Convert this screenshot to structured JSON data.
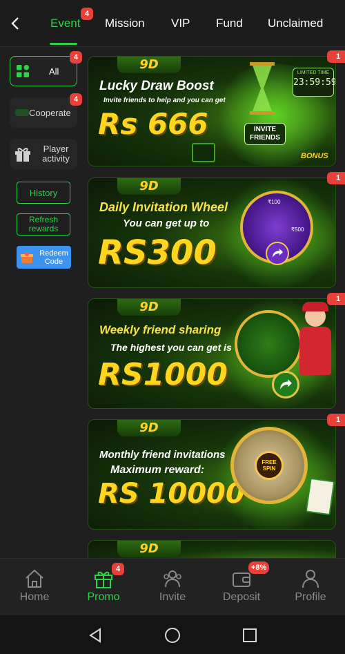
{
  "top_tabs": {
    "items": [
      {
        "label": "Event",
        "badge": "4"
      },
      {
        "label": "Mission"
      },
      {
        "label": "VIP"
      },
      {
        "label": "Fund"
      },
      {
        "label": "Unclaimed"
      }
    ],
    "active": "Event"
  },
  "sidebar": {
    "all": {
      "label": "All",
      "badge": "4"
    },
    "cooperate": {
      "label": "Cooperate",
      "badge": "4"
    },
    "player_activity": {
      "label": "Player activity"
    },
    "history": {
      "label": "History"
    },
    "refresh": {
      "label": "Refresh rewards"
    },
    "redeem": {
      "label": "Redeem Code"
    }
  },
  "banners": [
    {
      "logo": "9D",
      "title": "Lucky Draw Boost",
      "subtitle": "Invite friends to help and you can get",
      "amount": "Rs 666",
      "badge": "1",
      "timer_label": "LIMITED TIME",
      "timer": "23:59:59",
      "button": "INVITE FRIENDS",
      "tag": "BONUS"
    },
    {
      "logo": "9D",
      "title": "Daily Invitation Wheel",
      "subtitle": "You can get up to",
      "amount": "RS300",
      "badge": "1",
      "wheel_labels": [
        "₹100",
        "₹500"
      ]
    },
    {
      "logo": "9D",
      "title": "Weekly friend sharing",
      "subtitle": "The highest you can get is",
      "amount": "RS1000",
      "badge": "1"
    },
    {
      "logo": "9D",
      "title": "Monthly friend invitations",
      "subtitle": "Maximum reward:",
      "amount": "RS 10000",
      "badge": "1",
      "wheel_center": "FREE SPIN"
    },
    {
      "logo": "9D"
    }
  ],
  "bottom_nav": {
    "items": [
      {
        "label": "Home",
        "icon": "home-icon"
      },
      {
        "label": "Promo",
        "icon": "gift-icon",
        "badge": "4"
      },
      {
        "label": "Invite",
        "icon": "invite-icon"
      },
      {
        "label": "Deposit",
        "icon": "wallet-icon",
        "badge": "+8%"
      },
      {
        "label": "Profile",
        "icon": "profile-icon"
      }
    ],
    "active": "Promo"
  },
  "colors": {
    "accent": "#2fd24a",
    "badge": "#e8413a",
    "background": "#1f1f1f",
    "gold": "#ffd51e",
    "redeem": "#3d93f0"
  }
}
